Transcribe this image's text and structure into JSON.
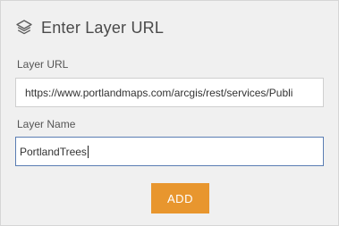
{
  "dialog": {
    "title": "Enter Layer URL",
    "icon": "layers-icon"
  },
  "fields": {
    "url": {
      "label": "Layer URL",
      "value": "https://www.portlandmaps.com/arcgis/rest/services/Publi"
    },
    "name": {
      "label": "Layer Name",
      "value": "PortlandTrees"
    }
  },
  "actions": {
    "add_label": "ADD"
  },
  "colors": {
    "panel_background": "#f0f0f0",
    "add_button": "#e8962e",
    "focused_border": "#5a7db3"
  }
}
